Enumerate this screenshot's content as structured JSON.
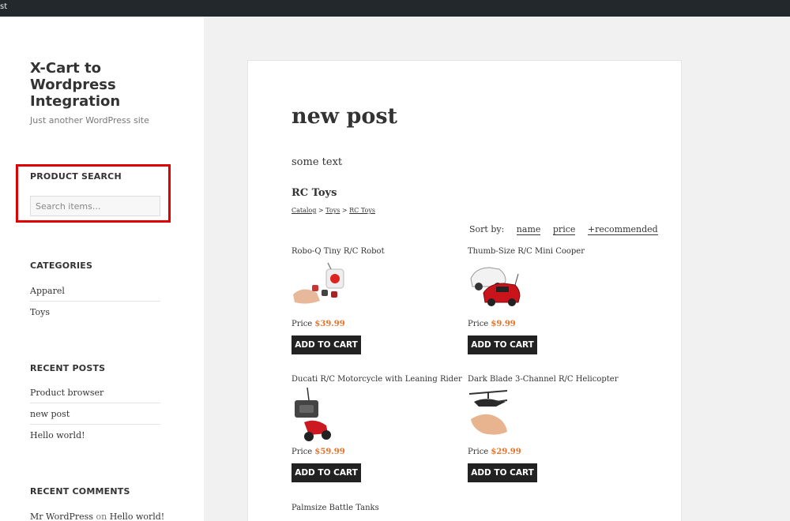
{
  "topbar": {
    "fragment": "st"
  },
  "site": {
    "title": "X-Cart to Wordpress Integration",
    "description": "Just another WordPress site"
  },
  "product_search": {
    "title": "PRODUCT SEARCH",
    "placeholder": "Search items..."
  },
  "categories": {
    "title": "CATEGORIES",
    "items": [
      "Apparel",
      "Toys"
    ]
  },
  "recent_posts": {
    "title": "RECENT POSTS",
    "items": [
      "Product browser",
      "new post",
      "Hello world!"
    ]
  },
  "recent_comments": {
    "title": "RECENT COMMENTS",
    "author": "Mr WordPress",
    "on": "on",
    "post": "Hello world!"
  },
  "post": {
    "title": "new post",
    "text": "some text"
  },
  "catalog": {
    "category_title": "RC Toys",
    "breadcrumb": [
      "Catalog",
      "Toys",
      "RC Toys"
    ],
    "breadcrumb_sep": ">",
    "sort_label": "Sort by:",
    "sort_options": [
      "name",
      "price",
      "+recommended"
    ]
  },
  "price_label": "Price",
  "cart_label": "ADD TO CART",
  "products": [
    {
      "name": "Robo-Q Tiny R/C Robot",
      "price": "$39.99"
    },
    {
      "name": "Thumb-Size R/C Mini Cooper",
      "price": "$9.99"
    },
    {
      "name": "Ducati R/C Motorcycle with Leaning Rider",
      "price": "$59.99"
    },
    {
      "name": "Dark Blade 3-Channel R/C Helicopter",
      "price": "$29.99"
    },
    {
      "name": "Palmsize Battle Tanks"
    }
  ],
  "colors": {
    "accent_price": "#e8732b",
    "highlight": "#e00000",
    "button": "#222222"
  }
}
